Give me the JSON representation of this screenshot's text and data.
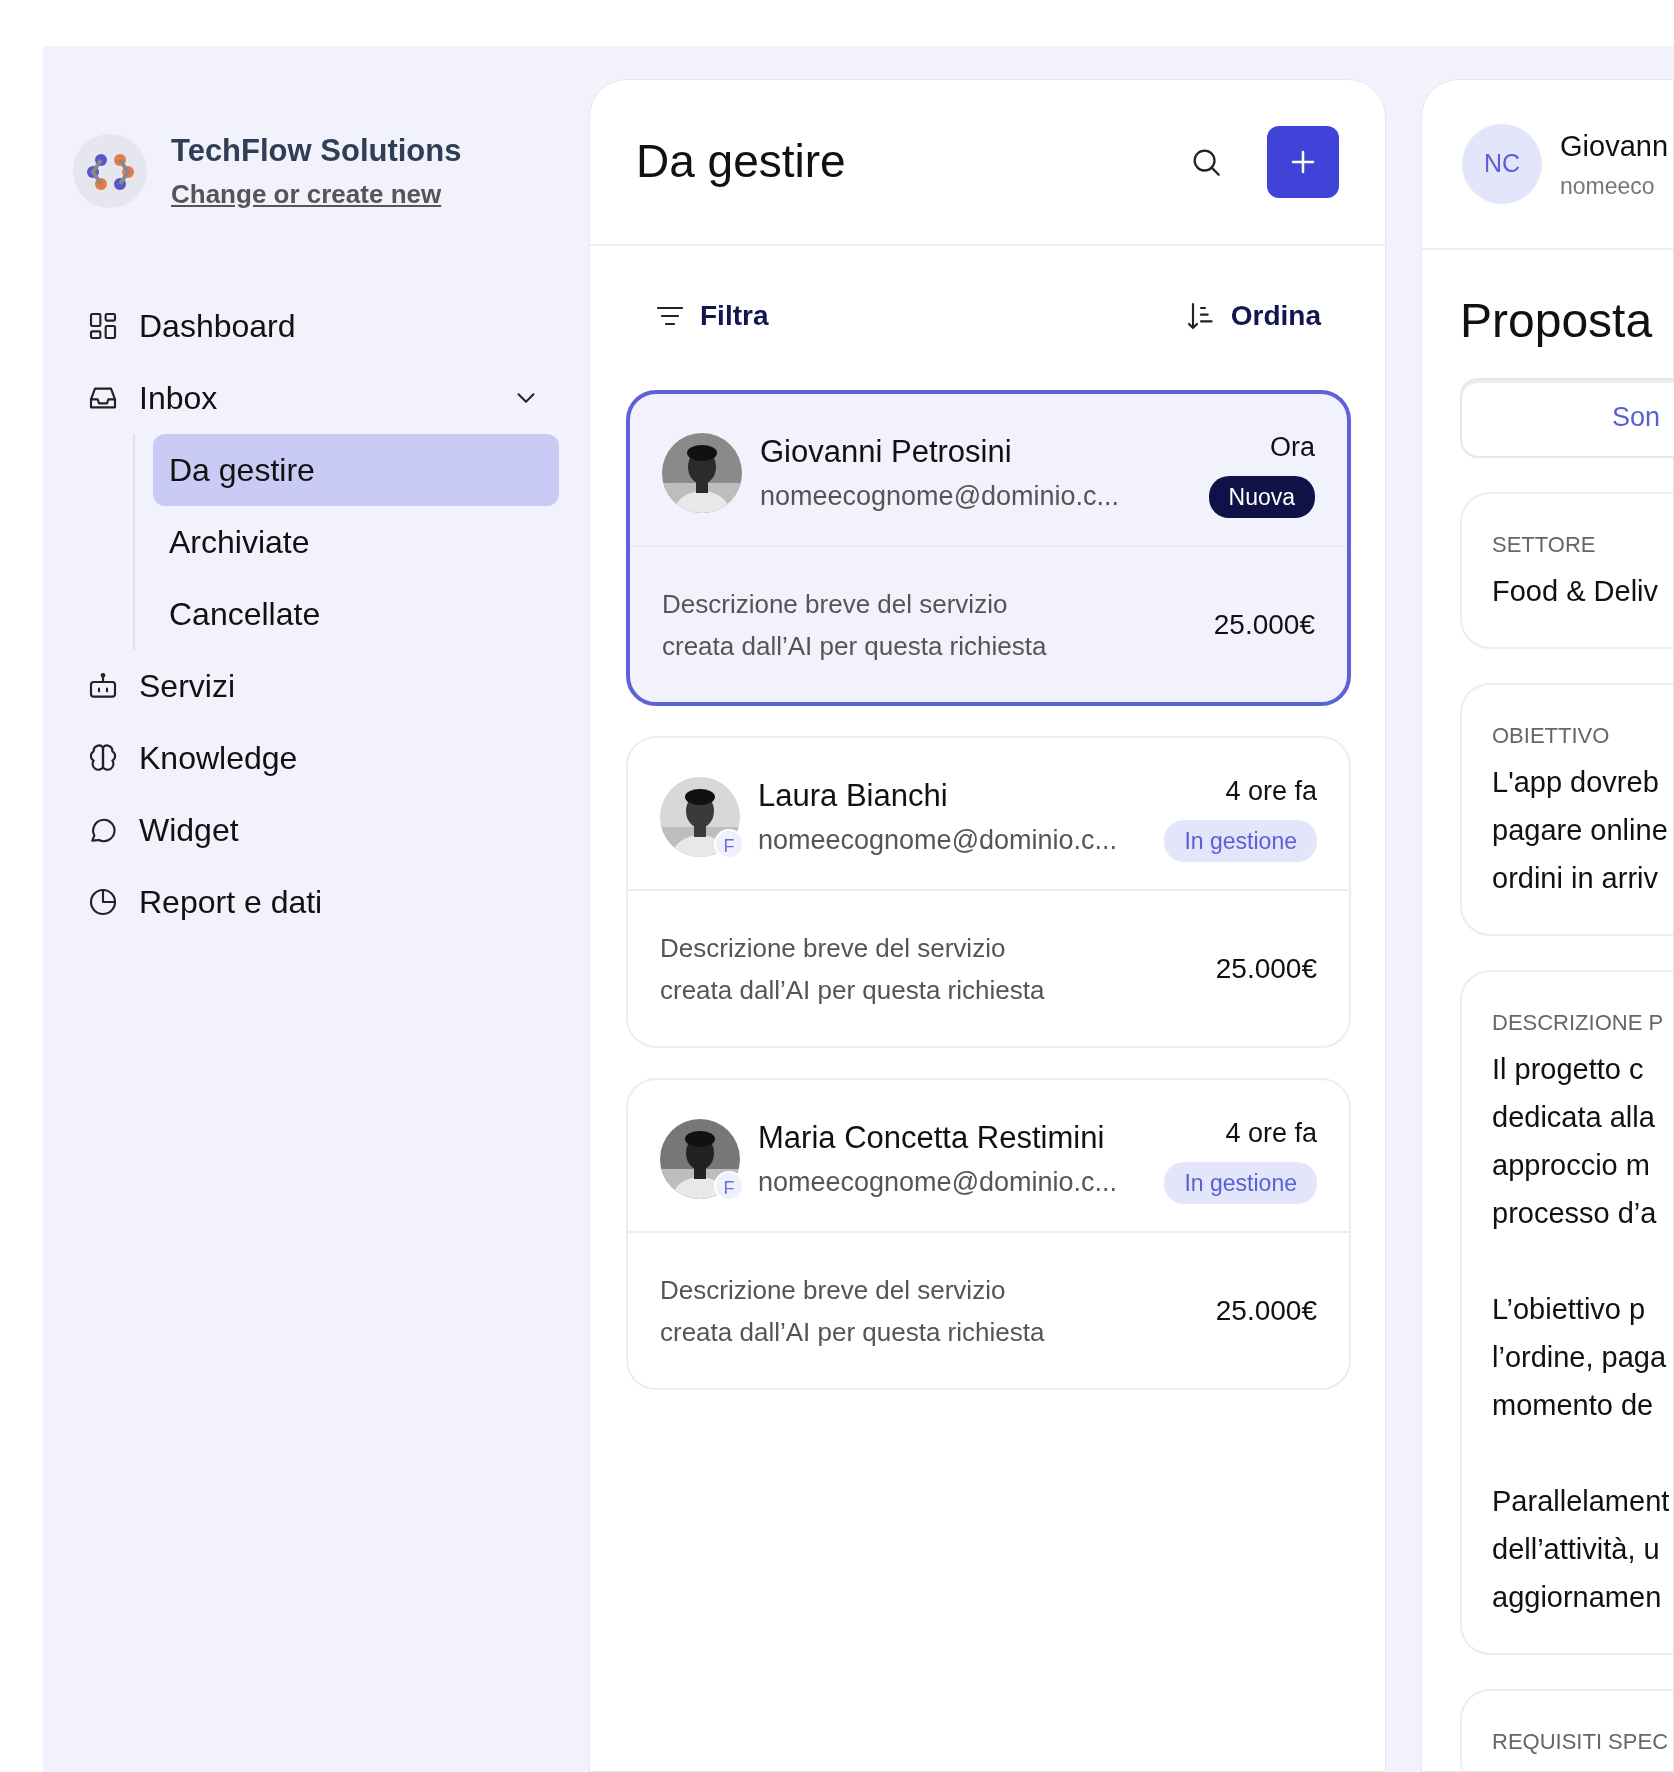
{
  "company": {
    "name": "TechFlow Solutions",
    "link": "Change or create new"
  },
  "nav": [
    {
      "label": "Dashboard"
    },
    {
      "label": "Inbox",
      "expanded": true,
      "children": [
        {
          "label": "Da gestire",
          "selected": true
        },
        {
          "label": "Archiviate",
          "selected": false
        },
        {
          "label": "Cancellate",
          "selected": false
        }
      ]
    },
    {
      "label": "Servizi"
    },
    {
      "label": "Knowledge"
    },
    {
      "label": "Widget"
    },
    {
      "label": "Report e dati"
    }
  ],
  "list": {
    "title": "Da gestire",
    "filter_label": "Filtra",
    "sort_label": "Ordina",
    "requests": [
      {
        "name": "Giovanni Petrosini",
        "email": "nomeecognome@dominio.c...",
        "time": "Ora",
        "status": {
          "label": "Nuova",
          "kind": "new"
        },
        "description": "Descrizione breve del servizio creata dall’AI per questa richiesta",
        "amount": "25.000€",
        "selected": true
      },
      {
        "name": "Laura Bianchi",
        "email": "nomeecognome@dominio.c...",
        "time": "4 ore fa",
        "status": {
          "label": "In gestione",
          "kind": "in_progress"
        },
        "avatar_badge": "F",
        "description": "Descrizione breve del servizio creata dall’AI per questa richiesta",
        "amount": "25.000€",
        "selected": false
      },
      {
        "name": "Maria Concetta Restimini",
        "email": "nomeecognome@dominio.c...",
        "time": "4 ore fa",
        "status": {
          "label": "In gestione",
          "kind": "in_progress"
        },
        "avatar_badge": "F",
        "description": "Descrizione breve del servizio creata dall’AI per questa richiesta",
        "amount": "25.000€",
        "selected": false
      }
    ]
  },
  "detail": {
    "initials": "NC",
    "name": "Giovann",
    "email": "nomeeco",
    "title": "Proposta",
    "tab_button": "Son",
    "sections": [
      {
        "label": "SETTORE",
        "paragraphs": [
          [
            "Food & Deliv"
          ]
        ]
      },
      {
        "label": "OBIETTIVO",
        "paragraphs": [
          [
            "L'app dovreb",
            "pagare online",
            "ordini in arriv"
          ]
        ]
      },
      {
        "label": "DESCRIZIONE P",
        "paragraphs": [
          [
            "Il progetto c",
            "dedicata alla",
            "approccio m",
            "processo d’a"
          ],
          [
            "L’obiettivo p",
            "l’ordine, paga",
            "momento de"
          ],
          [
            "Parallelament",
            "dell’attività, u",
            "aggiornamen"
          ]
        ]
      },
      {
        "label": "REQUISITI SPEC"
      }
    ]
  }
}
